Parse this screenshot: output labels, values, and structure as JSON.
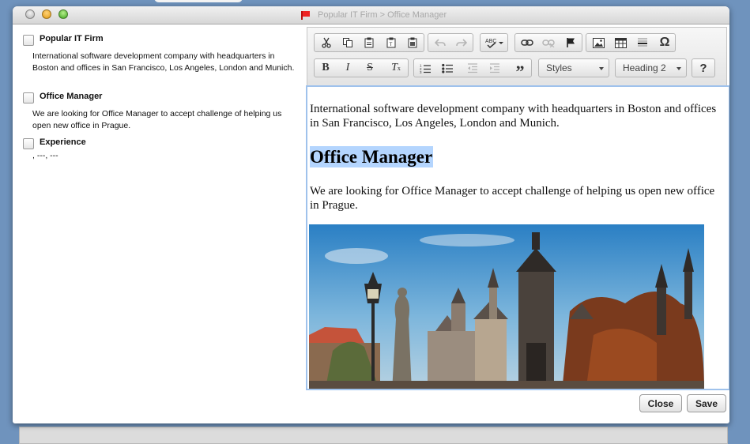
{
  "window": {
    "title": "Popular IT Firm > Office Manager"
  },
  "left_panel": {
    "items": [
      {
        "title": "Popular IT Firm",
        "description": "International software development company with headquarters in Boston and offices in San Francisco, Los Angeles, London and Munich."
      },
      {
        "title": "Office Manager",
        "description": "We are looking for Office Manager to accept challenge of helping us open new office in Prague."
      },
      {
        "title": "Experience",
        "description": ", ---, ---"
      }
    ]
  },
  "toolbar": {
    "styles_label": "Styles",
    "format_label": "Heading 2",
    "help_label": "?",
    "icons": [
      "cut-icon",
      "copy-icon",
      "paste-icon",
      "paste-text-icon",
      "paste-word-icon",
      "undo-icon",
      "redo-icon",
      "spellcheck-icon",
      "link-icon",
      "unlink-icon",
      "anchor-icon",
      "image-icon",
      "table-icon",
      "horizontal-line-icon",
      "special-char-icon",
      "bold-icon",
      "italic-icon",
      "strike-icon",
      "remove-format-icon",
      "numbered-list-icon",
      "bulleted-list-icon",
      "outdent-icon",
      "indent-icon",
      "blockquote-icon"
    ]
  },
  "editor": {
    "paragraph1": "International software development company with headquarters in Boston and offices in San Francisco, Los Angeles, London and Munich.",
    "heading": "Office Manager",
    "paragraph2": "We are looking for Office Manager to accept challenge of helping us open new office in Prague."
  },
  "actions": {
    "close_label": "Close",
    "save_label": "Save"
  }
}
